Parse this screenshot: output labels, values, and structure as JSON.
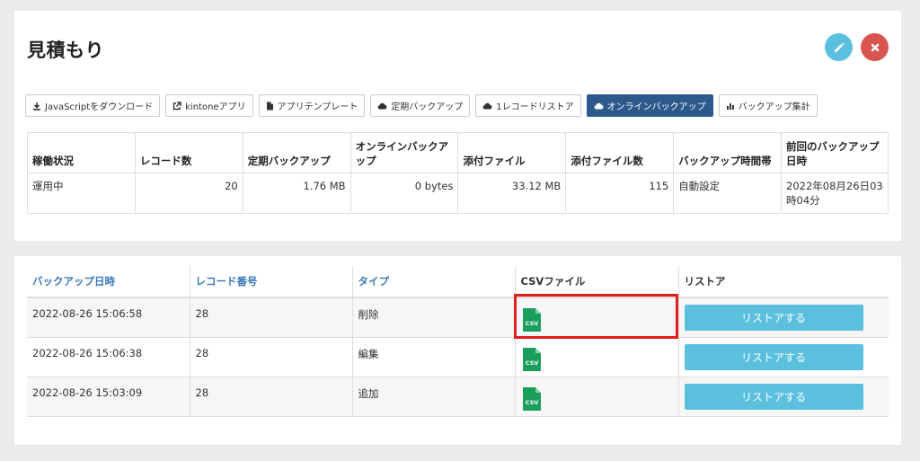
{
  "page": {
    "title": "見積もり"
  },
  "toolbar": {
    "buttons": [
      {
        "label": "JavaScriptをダウンロード",
        "icon": "download-icon"
      },
      {
        "label": "kintoneアプリ",
        "icon": "external-link-icon"
      },
      {
        "label": "アプリテンプレート",
        "icon": "file-icon"
      },
      {
        "label": "定期バックアップ",
        "icon": "cloud-icon"
      },
      {
        "label": "1レコードリストア",
        "icon": "cloud-icon"
      },
      {
        "label": "オンラインバックアップ",
        "icon": "cloud-icon",
        "active": true
      },
      {
        "label": "バックアップ集計",
        "icon": "bar-chart-icon"
      }
    ]
  },
  "stats": {
    "headers": [
      "稼働状況",
      "レコード数",
      "定期バックアップ",
      "オンラインバックアップ",
      "添付ファイル",
      "添付ファイル数",
      "バックアップ時間帯",
      "前回のバックアップ日時"
    ],
    "row": [
      "運用中",
      "20",
      "1.76 MB",
      "0 bytes",
      "33.12 MB",
      "115",
      "自動設定",
      "2022年08月26日03時04分"
    ]
  },
  "history": {
    "headers": [
      "バックアップ日時",
      "レコード番号",
      "タイプ",
      "CSVファイル",
      "リストア"
    ],
    "rows": [
      {
        "datetime": "2022-08-26 15:06:58",
        "record": "28",
        "type": "削除",
        "csv": "CSV",
        "restore": "リストアする"
      },
      {
        "datetime": "2022-08-26 15:06:38",
        "record": "28",
        "type": "編集",
        "csv": "CSV",
        "restore": "リストアする"
      },
      {
        "datetime": "2022-08-26 15:03:09",
        "record": "28",
        "type": "追加",
        "csv": "CSV",
        "restore": "リストアする"
      }
    ]
  },
  "colors": {
    "accent_blue": "#5bc0de",
    "active_button": "#2d5a8c",
    "link_blue": "#3b79b8",
    "close_red": "#d9534f",
    "highlight_red": "#e01e1e",
    "csv_green": "#1a9e5c"
  }
}
